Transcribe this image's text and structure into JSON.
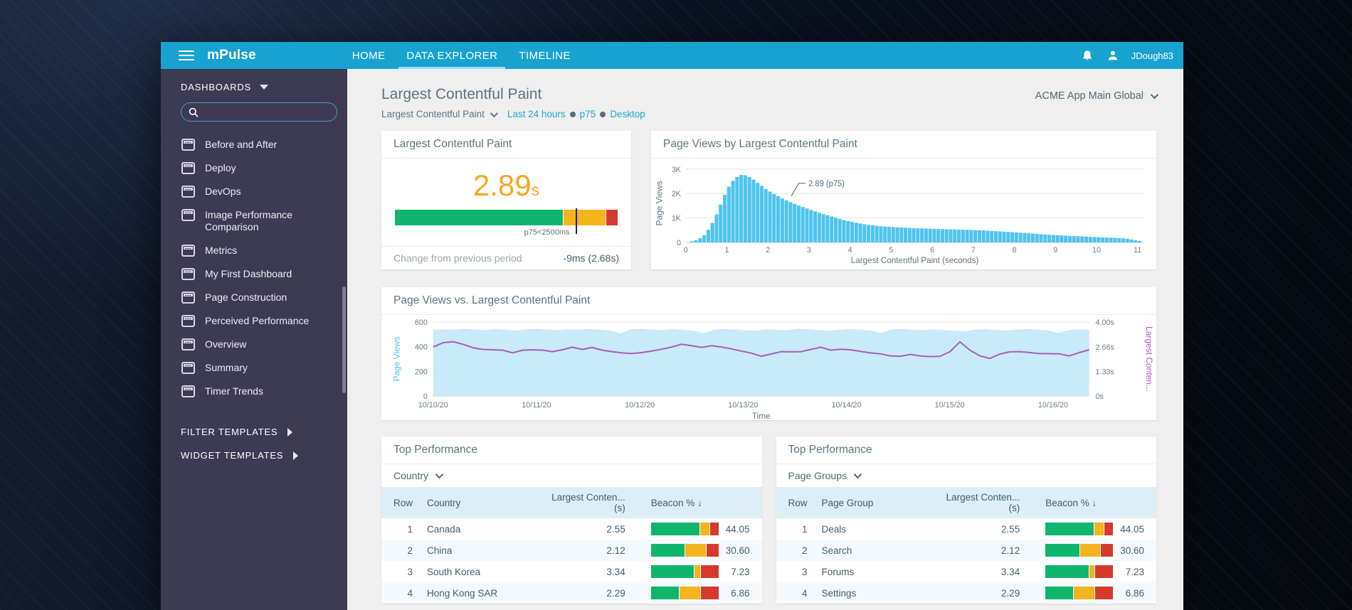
{
  "topbar": {
    "brand": "mPulse",
    "nav": [
      {
        "label": "HOME",
        "active": false
      },
      {
        "label": "DATA EXPLORER",
        "active": true
      },
      {
        "label": "TIMELINE",
        "active": false
      }
    ],
    "username": "JDough83"
  },
  "sidebar": {
    "section_label": "DASHBOARDS",
    "search_value": "",
    "items": [
      "Before and After",
      "Deploy",
      "DevOps",
      "Image Performance Comparison",
      "Metrics",
      "My First Dashboard",
      "Page Construction",
      "Perceived Performance",
      "Overview",
      "Summary",
      "Timer Trends"
    ],
    "templates": [
      "FILTER TEMPLATES",
      "WIDGET TEMPLATES"
    ]
  },
  "header": {
    "title": "Largest Contentful Paint",
    "metric_dropdown": "Largest Contentful Paint",
    "filters": [
      "Last 24 hours",
      "p75",
      "Desktop"
    ],
    "app_selector": "ACME App Main Global"
  },
  "lcp_widget": {
    "title": "Largest Contentful Paint",
    "value": "2.89",
    "unit": "s",
    "gauge_segments": [
      {
        "color": "#10b56d",
        "pct": 76
      },
      {
        "color": "#f5b31c",
        "pct": 19
      },
      {
        "color": "#d6392e",
        "pct": 5
      }
    ],
    "marker_pct": 81,
    "marker_label": "p75<2500ms",
    "footer_label": "Change from previous period",
    "footer_value": "-9ms (2.68s)"
  },
  "tables": [
    {
      "title": "Top Performance",
      "dimension": "Country",
      "columns": [
        "Row",
        "Country",
        "Largest Conten... (s)",
        "Beacon % ↓"
      ],
      "rows": [
        {
          "row": 1,
          "name": "Canada",
          "lcp": "2.55",
          "beacon": "44.05",
          "bar": [
            73,
            14,
            13
          ]
        },
        {
          "row": 2,
          "name": "China",
          "lcp": "2.12",
          "beacon": "30.60",
          "bar": [
            51,
            31,
            18
          ]
        },
        {
          "row": 3,
          "name": "South Korea",
          "lcp": "3.34",
          "beacon": "7.23",
          "bar": [
            65,
            8,
            27
          ]
        },
        {
          "row": 4,
          "name": "Hong Kong SAR",
          "lcp": "2.29",
          "beacon": "6.86",
          "bar": [
            42,
            31,
            27
          ]
        }
      ]
    },
    {
      "title": "Top Performance",
      "dimension": "Page Groups",
      "columns": [
        "Row",
        "Page Group",
        "Largest Conten... (s)",
        "Beacon % ↓"
      ],
      "rows": [
        {
          "row": 1,
          "name": "Deals",
          "lcp": "2.55",
          "beacon": "44.05",
          "bar": [
            73,
            14,
            13
          ]
        },
        {
          "row": 2,
          "name": "Search",
          "lcp": "2.12",
          "beacon": "30.60",
          "bar": [
            51,
            31,
            18
          ]
        },
        {
          "row": 3,
          "name": "Forums",
          "lcp": "3.34",
          "beacon": "7.23",
          "bar": [
            65,
            8,
            27
          ]
        },
        {
          "row": 4,
          "name": "Settings",
          "lcp": "2.29",
          "beacon": "6.86",
          "bar": [
            42,
            31,
            27
          ]
        }
      ]
    }
  ],
  "bar_colors": [
    "#10b56d",
    "#f5b31c",
    "#d6392e"
  ],
  "chart_data": [
    {
      "id": "histogram",
      "type": "bar",
      "title": "Page Views by Largest Contentful Paint",
      "xlabel": "Largest Contentful Paint (seconds)",
      "ylabel": "Page Views",
      "bar_color": "#4fc4ee",
      "xlim": [
        0,
        11.15
      ],
      "ylim": [
        0,
        3200
      ],
      "xticks": [
        0,
        1,
        2,
        3,
        4,
        5,
        6,
        7,
        8,
        9,
        10,
        11
      ],
      "yticks": [
        {
          "v": 0,
          "label": "0"
        },
        {
          "v": 1000,
          "label": "1K"
        },
        {
          "v": 2000,
          "label": "2K"
        },
        {
          "v": 3000,
          "label": "3K"
        }
      ],
      "annotation": {
        "text": "2.89 (p75)",
        "x": 2.89
      },
      "x_start": 0.05,
      "bin_width": 0.1,
      "values": [
        8,
        40,
        90,
        170,
        300,
        520,
        800,
        1150,
        1550,
        1950,
        2280,
        2520,
        2680,
        2760,
        2750,
        2680,
        2570,
        2440,
        2310,
        2190,
        2080,
        1980,
        1890,
        1800,
        1720,
        1650,
        1580,
        1510,
        1450,
        1390,
        1330,
        1270,
        1215,
        1160,
        1110,
        1060,
        1010,
        965,
        915,
        875,
        840,
        805,
        775,
        745,
        720,
        700,
        680,
        665,
        650,
        640,
        630,
        618,
        610,
        600,
        592,
        585,
        578,
        572,
        566,
        560,
        555,
        550,
        545,
        540,
        535,
        530,
        525,
        520,
        515,
        510,
        505,
        498,
        490,
        480,
        470,
        460,
        450,
        440,
        430,
        420,
        408,
        396,
        384,
        372,
        360,
        348,
        337,
        326,
        315,
        305,
        295,
        286,
        277,
        268,
        260,
        252,
        244,
        236,
        228,
        221,
        214,
        207,
        200,
        193,
        186,
        178,
        168,
        150,
        120,
        85,
        60
      ]
    },
    {
      "id": "timeseries",
      "type": "area",
      "title": "Page Views vs. Largest Contentful Paint",
      "xlabel": "Time",
      "x_labels": [
        "10/10/20",
        "10/11/20",
        "10/12/20",
        "10/13/20",
        "10/14/20",
        "10/15/20",
        "10/16/20"
      ],
      "x_span_days": 6.35,
      "left_axis": {
        "label": "Page Views",
        "color": "#4fc4ee",
        "ticks": [
          {
            "v": 0,
            "label": "0"
          },
          {
            "v": 200,
            "label": "200"
          },
          {
            "v": 400,
            "label": "400"
          },
          {
            "v": 600,
            "label": "600"
          }
        ],
        "max": 600
      },
      "right_axis": {
        "label": "Largest Conten...",
        "color": "#a55fb4",
        "ticks": [
          {
            "v": 0,
            "label": "0s"
          },
          {
            "v": 1.33,
            "label": "1.33s"
          },
          {
            "v": 2.66,
            "label": "2.66s"
          },
          {
            "v": 4,
            "label": "4.00s"
          }
        ],
        "max": 4
      },
      "series": [
        {
          "name": "Page Views",
          "kind": "area",
          "color": "#c9eaf8",
          "values": [
            536,
            542,
            538,
            545,
            540,
            536,
            543,
            538,
            532,
            540,
            545,
            538,
            534,
            541,
            537,
            544,
            539,
            533,
            508,
            541,
            545,
            539,
            535,
            543,
            537,
            531,
            510,
            538,
            544,
            540,
            534,
            529,
            542,
            538,
            533,
            545,
            540,
            535,
            530,
            537,
            543,
            538,
            532,
            512,
            540,
            545,
            539,
            534,
            541,
            536,
            530,
            525,
            538,
            543,
            537,
            532,
            539,
            544,
            538,
            533,
            511,
            535,
            541,
            537
          ]
        },
        {
          "name": "Largest Contentful Paint (s)",
          "kind": "line",
          "color": "#a55fb4",
          "values": [
            2.65,
            2.88,
            2.94,
            2.8,
            2.61,
            2.52,
            2.5,
            2.48,
            2.33,
            2.48,
            2.5,
            2.48,
            2.4,
            2.5,
            2.64,
            2.52,
            2.63,
            2.48,
            2.4,
            2.33,
            2.3,
            2.35,
            2.43,
            2.53,
            2.65,
            2.8,
            2.72,
            2.63,
            2.72,
            2.65,
            2.55,
            2.43,
            2.32,
            2.15,
            2.27,
            2.4,
            2.39,
            2.4,
            2.52,
            2.64,
            2.48,
            2.53,
            2.5,
            2.41,
            2.33,
            2.28,
            2.17,
            2.15,
            2.25,
            2.17,
            2.13,
            2.15,
            2.4,
            2.93,
            2.48,
            2.17,
            2.03,
            2.27,
            2.39,
            2.4,
            2.35,
            2.3,
            2.29,
            2.28,
            2.17,
            2.35,
            2.5
          ]
        }
      ]
    }
  ]
}
